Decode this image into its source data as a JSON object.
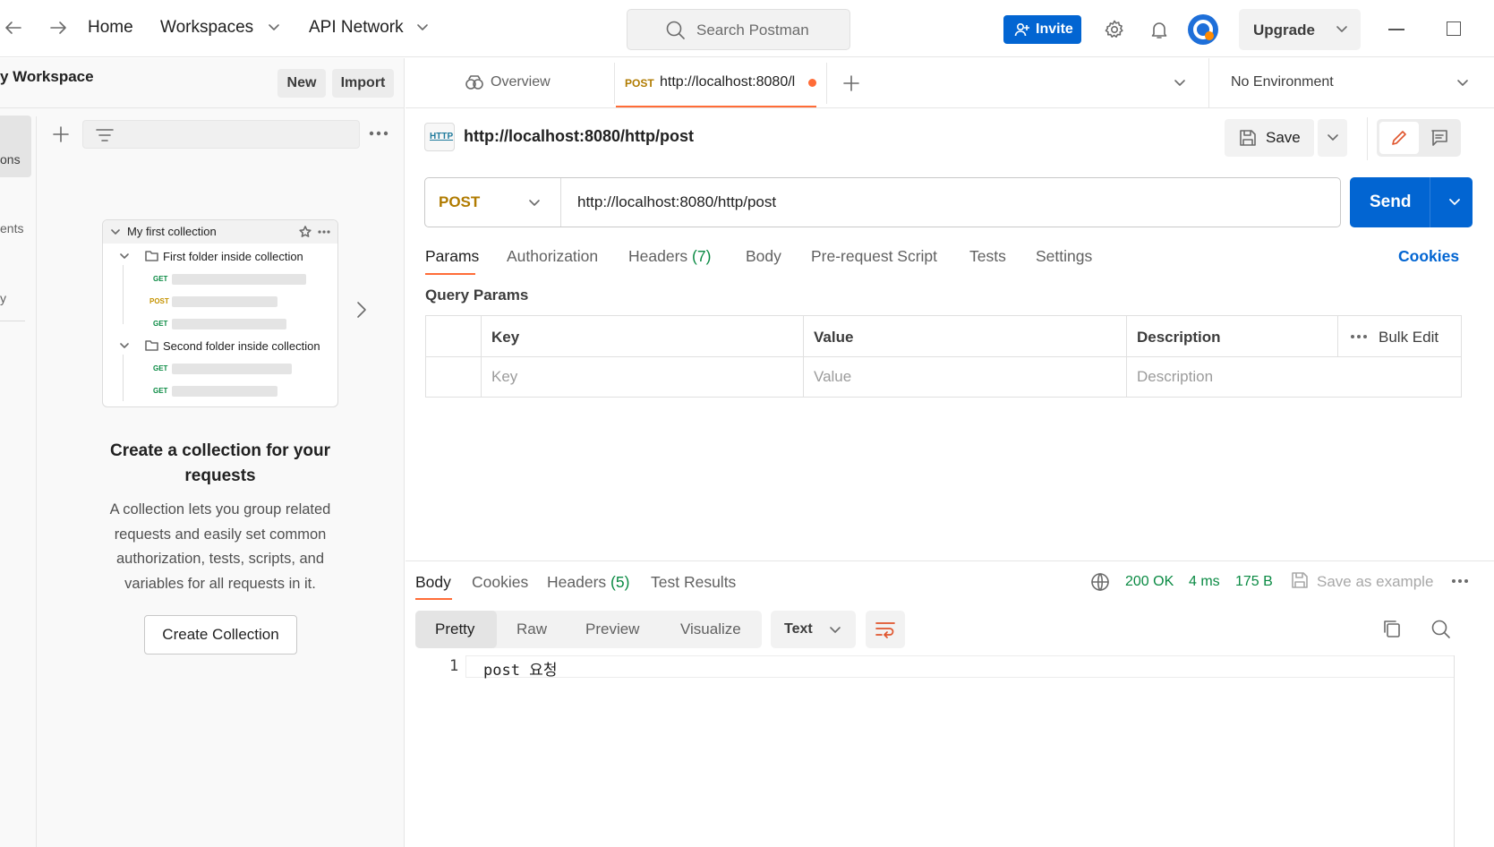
{
  "topbar": {
    "home": "Home",
    "workspaces": "Workspaces",
    "api_network": "API Network",
    "search_placeholder": "Search Postman",
    "invite": "Invite",
    "upgrade": "Upgrade"
  },
  "sidebar": {
    "workspace_name": "y Workspace",
    "new_button": "New",
    "import_button": "Import",
    "rail": [
      "ons",
      "ents",
      "y"
    ],
    "preview": {
      "collection": "My first collection",
      "folder1": "First folder inside collection",
      "folder2": "Second folder inside collection",
      "methods": [
        "GET",
        "POST",
        "GET",
        "GET",
        "GET"
      ]
    },
    "empty_title": "Create a collection for your requests",
    "empty_desc": "A collection lets you group related requests and easily set common authorization, tests, scripts, and variables for all requests in it.",
    "create_button": "Create Collection"
  },
  "tabs": {
    "overview": "Overview",
    "active_method": "POST",
    "active_label": "http://localhost:8080/l",
    "environment": "No Environment"
  },
  "request": {
    "name": "http://localhost:8080/http/post",
    "save": "Save",
    "method": "POST",
    "url": "http://localhost:8080/http/post",
    "send": "Send",
    "tabs": [
      "Params",
      "Authorization",
      "Headers",
      "Body",
      "Pre-request Script",
      "Tests",
      "Settings"
    ],
    "headers_count": "(7)",
    "cookies": "Cookies",
    "query_params_title": "Query Params",
    "columns": {
      "key": "Key",
      "value": "Value",
      "description": "Description",
      "bulk_edit": "Bulk Edit"
    },
    "placeholders": {
      "key": "Key",
      "value": "Value",
      "description": "Description"
    }
  },
  "response": {
    "tabs": [
      "Body",
      "Cookies",
      "Headers",
      "Test Results"
    ],
    "headers_count": "(5)",
    "status": "200 OK",
    "time": "4 ms",
    "size": "175 B",
    "save_example": "Save as example",
    "views": [
      "Pretty",
      "Raw",
      "Preview",
      "Visualize"
    ],
    "format": "Text",
    "line_number": "1",
    "body": "post 요청"
  },
  "colors": {
    "accent": "#0265d2",
    "tab_underline": "#ff6c37",
    "status_ok": "#0a8a43",
    "method_post": "#b07b00"
  }
}
